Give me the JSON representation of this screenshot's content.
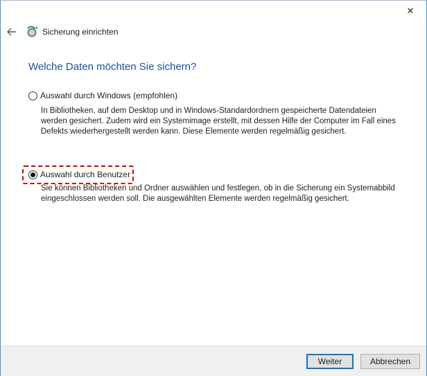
{
  "window": {
    "title": "Sicherung einrichten",
    "close_glyph": "✕"
  },
  "page": {
    "heading": "Welche Daten möchten Sie sichern?"
  },
  "options": [
    {
      "label": "Auswahl durch Windows (empfohlen)",
      "selected": false,
      "description": "In Bibliotheken, auf dem Desktop und in Windows-Standardordnern gespeicherte Datendateien werden gesichert. Zudem wird ein Systemimage erstellt, mit dessen Hilfe der Computer im Fall eines Defekts wiederhergestellt werden kann. Diese Elemente werden regelmäßig gesichert."
    },
    {
      "label": "Auswahl durch Benutzer",
      "selected": true,
      "description": "Sie können Bibliotheken und Ordner auswählen und festlegen, ob in die Sicherung ein Systemabbild eingeschlossen werden soll. Die ausgewählten Elemente werden regelmäßig gesichert."
    }
  ],
  "footer": {
    "next_label": "Weiter",
    "cancel_label": "Abbrechen"
  },
  "icons": {
    "back": "arrow-left-icon",
    "app": "backup-icon",
    "close": "close-icon"
  },
  "colors": {
    "heading": "#1d4fa0",
    "highlight": "#d00000",
    "primary_border": "#0078d7"
  }
}
